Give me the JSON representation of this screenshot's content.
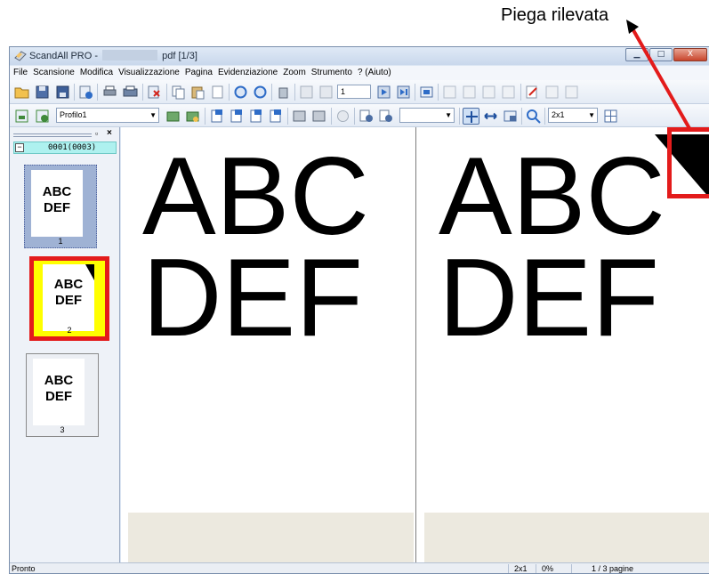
{
  "callout": {
    "label": "Piega rilevata",
    "color": "#e31b1b"
  },
  "window": {
    "title_prefix": "ScandAll PRO -",
    "title_suffix": "pdf [1/3]",
    "controls": {
      "minimize": "▁",
      "maximize": "□",
      "close": "X"
    }
  },
  "menu": [
    "File",
    "Scansione",
    "Modifica",
    "Visualizzazione",
    "Pagina",
    "Evidenziazione",
    "Zoom",
    "Strumento",
    "? (Aiuto)"
  ],
  "toolbar": {
    "page_number": "1",
    "profile": "Profilo1",
    "zoom_select": "",
    "layout_select": "2x1"
  },
  "side_panel": {
    "restore_glyph": "▫",
    "close_glyph": "×",
    "batch_toggle": "−",
    "batch_label": "0001(0003)",
    "thumbnails": [
      {
        "line1": "ABC",
        "line2": "DEF",
        "number": "1",
        "state": "selected"
      },
      {
        "line1": "ABC",
        "line2": "DEF",
        "number": "2",
        "state": "crease-detected"
      },
      {
        "line1": "ABC",
        "line2": "DEF",
        "number": "3",
        "state": "normal"
      }
    ]
  },
  "viewer": {
    "left_page": {
      "line1": "ABC",
      "line2": "DEF"
    },
    "right_page": {
      "line1": "ABC",
      "line2": "DEF"
    }
  },
  "status": {
    "ready": "Pronto",
    "layout": "2x1",
    "percent": "0%",
    "pages": "1 / 3 pagine"
  }
}
